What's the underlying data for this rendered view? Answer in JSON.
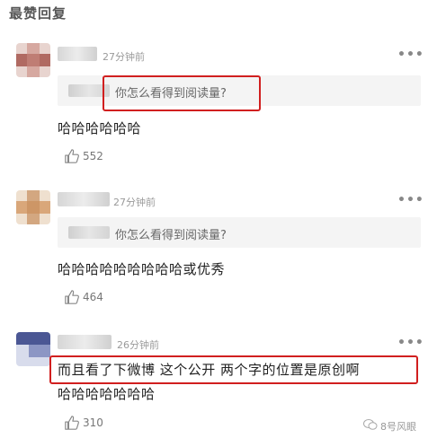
{
  "section_title": "最赞回复",
  "comments": [
    {
      "time": "27分钟前",
      "quote": "你怎么看得到阅读量?",
      "text": "哈哈哈哈哈哈",
      "likes": "552",
      "more": "•••"
    },
    {
      "time": "27分钟前",
      "quote": "你怎么看得到阅读量?",
      "text": "哈哈哈哈哈哈哈哈哈或优秀",
      "likes": "464",
      "more": "•••"
    },
    {
      "time": "26分钟前",
      "text_line1": "而且看了下微博 这个公开 两个字的位置是原创啊",
      "text_line2": "哈哈哈哈哈哈哈",
      "likes": "310",
      "more": "•••"
    }
  ],
  "watermark": "8号风眼",
  "colors": {
    "highlight": "#d11f1f",
    "quote_bg": "#f4f4f4"
  }
}
